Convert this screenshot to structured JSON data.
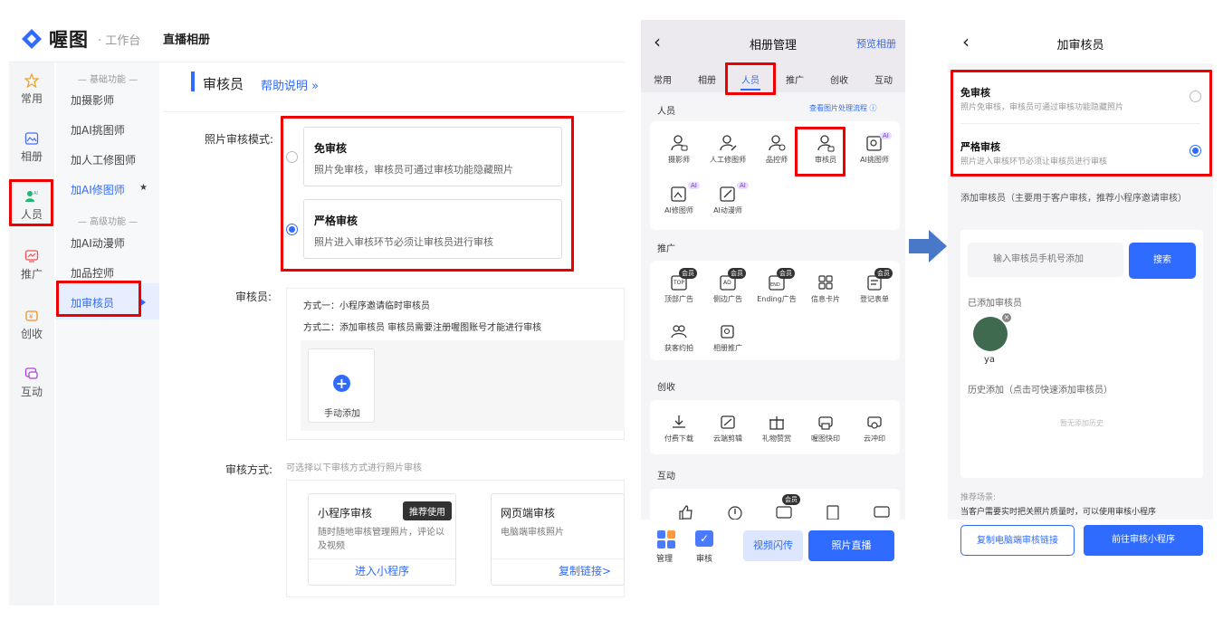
{
  "desktop": {
    "logo_text": "喔图",
    "logo_sub": "· 工作台",
    "breadcrumb": "直播相册",
    "rail": [
      "常用",
      "相册",
      "人员",
      "推广",
      "创收",
      "互动"
    ],
    "subnav": {
      "sec_basic": "— 基础功能 —",
      "items_basic": [
        "加摄影师",
        "加AI挑图师",
        "加人工修图师",
        "加AI修图师"
      ],
      "star": "★",
      "sec_adv": "— 高级功能 —",
      "items_adv": [
        "加AI动漫师",
        "加品控师",
        "加审核员"
      ]
    },
    "header": {
      "title": "审核员",
      "help": "帮助说明 »"
    },
    "mode_label": "照片审核模式:",
    "options": [
      {
        "title": "免审核",
        "desc": "照片免审核，审核员可通过审核功能隐藏照片",
        "selected": false
      },
      {
        "title": "严格审核",
        "desc": "照片进入审核环节必须让审核员进行审核",
        "selected": true
      }
    ],
    "reviewer_label": "审核员:",
    "way1": "方式一：小程序邀请临时审核员",
    "way2": "方式二：添加审核员   审核员需要注册喔图账号才能进行审核",
    "manual_add": "手动添加",
    "method_label": "审核方式:",
    "method_hint": "可选择以下审核方式进行照片审核",
    "methods": [
      {
        "title": "小程序审核",
        "tag": "推荐使用",
        "desc": "随时随地审核管理照片，评论以及视频",
        "link": "进入小程序"
      },
      {
        "title": "网页端审核",
        "desc": "电脑端审核照片",
        "link": "复制链接>"
      }
    ]
  },
  "phone": {
    "title": "相册管理",
    "preview": "预览相册",
    "tabs": [
      "常用",
      "相册",
      "人员",
      "推广",
      "创收",
      "互动"
    ],
    "active_tab": "人员",
    "people": {
      "title": "人员",
      "flow_link": "查看图片处理流程 ⓘ",
      "items": [
        "摄影师",
        "人工修图师",
        "品控师",
        "审核员",
        "AI挑图师",
        "AI修图师",
        "AI动漫师"
      ]
    },
    "promo": {
      "title": "推广",
      "items": [
        "顶部广告",
        "侧边广告",
        "Ending广告",
        "信息卡片",
        "登记表单",
        "获客约拍",
        "相册推广"
      ]
    },
    "revenue": {
      "title": "创收",
      "items": [
        "付费下载",
        "云端剪辑",
        "礼物赞赏",
        "喔图快印",
        "云冲印"
      ]
    },
    "interact_title": "互动",
    "badge_vip": "会员",
    "badge_ai": "AI",
    "bottom": {
      "manage": "管理",
      "review": "审核",
      "video": "视频闪传",
      "live": "照片直播"
    }
  },
  "add_reviewer": {
    "title": "加审核员",
    "options": [
      {
        "title": "免审核",
        "desc": "照片免审核，审核员可通过审核功能隐藏照片",
        "selected": false
      },
      {
        "title": "严格审核",
        "desc": "照片进入审核环节必须让审核员进行审核",
        "selected": true
      }
    ],
    "add_hint": "添加审核员（主要用于客户审核，推荐小程序邀请审核）",
    "input_placeholder": "输入审核员手机号添加",
    "search": "搜索",
    "added_title": "已添加审核员",
    "reviewer_name": "ya",
    "history_title": "历史添加（点击可快速添加审核员）",
    "no_history": "暂无添加历史",
    "scene_title": "推荐场景:",
    "scene_desc": "当客户需要实时把关照片质量时，可以使用审核小程序",
    "copy_link": "复制电脑端审核链接",
    "goto_mini": "前往审核小程序"
  },
  "colors": {
    "accent": "#2f6bff",
    "highlight": "#e00000"
  }
}
